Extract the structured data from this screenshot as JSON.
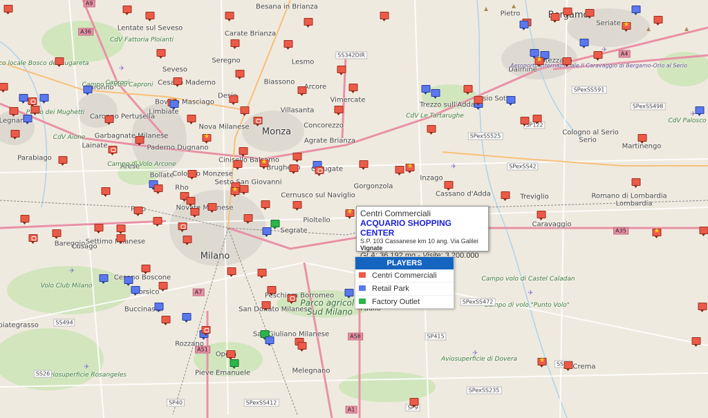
{
  "map": {
    "places": [
      {
        "name": "Milano",
        "kind": "city"
      },
      {
        "name": "Monza",
        "kind": "city"
      },
      {
        "name": "Bergamo",
        "kind": "city"
      },
      {
        "name": "Crema",
        "kind": "town"
      },
      {
        "name": "Caravaggio",
        "kind": "town"
      },
      {
        "name": "Treviglio",
        "kind": "town"
      },
      {
        "name": "Vignate",
        "kind": "town"
      }
    ],
    "labels": [
      "Besana in Brianza",
      "Lentate sul Seveso",
      "Carate Brianza",
      "Seveso",
      "Seregno",
      "Lesmo",
      "Cesano Maderno",
      "Desio",
      "Biassono",
      "Arcore",
      "Vimercate",
      "Saronno",
      "Bovisio Masciago",
      "Limbiate",
      "Villasanta",
      "Concorezzo",
      "Nova Milanese",
      "Caronno Pertusella",
      "Legnano",
      "Garbagnate Milanese",
      "Paderno Dugnano",
      "Agrate Brianza",
      "Lainate",
      "Cinisello Balsamo",
      "Brugherio",
      "Carugate",
      "Gorgonzola",
      "Inzago",
      "Cassano d'Adda",
      "Parabiago",
      "Arese",
      "Bollate",
      "Cologno Monzese",
      "Sesto San Giovanni",
      "Cernusco sul Naviglio",
      "Rho",
      "Pero",
      "Novate Milanese",
      "Pioltello",
      "Segrate",
      "Settimo Milanese",
      "Bareggio",
      "Cusago",
      "Cesano Boscone",
      "Corsico",
      "Buccinasco",
      "San Donato Milanese",
      "Peschiera Borromeo",
      "Paullo",
      "Rozzano",
      "Opera",
      "San Giuliano Milanese",
      "Pieve Emanuele",
      "Melegnano",
      "Abbiategrasso",
      "Trezzo sull'Adda",
      "Osio Sotto",
      "Dalmine",
      "Stezzano",
      "Seriate",
      "Pietro",
      "Cologno al Serio",
      "Martinengo",
      "Romano di Lombardia",
      "Lombardia",
      "Serio"
    ],
    "parks": [
      "CdV Fattoria Ploianti",
      "Parco locale Bosco del Rugareta",
      "Campo di Volo Caproni",
      "Parco dei Mughetti",
      "CdV Aione",
      "Campo di Volo Arcone",
      "CdV Le Tartarughe",
      "CdV Palosco",
      "Volo Club Milano",
      "Aviosuperficie Rosangeles",
      "Aviosuperficie di Dovera",
      "Campo di volo \"Punto Volo\"",
      "Campo volo di Castel Caladan",
      "Caproni"
    ],
    "park_big": [
      "Parco agricolo",
      "Sud Milano"
    ],
    "airport": "Aeroporto internazionale Il Caravaggio di Bergamo-Orio al Serio",
    "roads": [
      "A36",
      "A9",
      "A4",
      "A35",
      "A58",
      "A1",
      "A7",
      "A51",
      "SS342DIR",
      "SS494",
      "SS26",
      "SP40",
      "SPexSS412",
      "SP9",
      "SP415",
      "SPexSS591",
      "SPexSS498",
      "SPexSS525",
      "SPexSS472",
      "SPexSS235",
      "SPexSS42",
      "SP122",
      "SS35"
    ]
  },
  "popup": {
    "category": "Centri Commerciali",
    "name": "ACQUARIO SHOPPING CENTER",
    "address": "S.P. 103 Cassanese km 10 ang. Via Galilei",
    "city": "Vignate",
    "gla_label": "GLA",
    "gla_value": "36.192 mq",
    "visits_label": "Visite",
    "visits_value": "3.200.000"
  },
  "legend": {
    "title": "PLAYERS",
    "items": [
      {
        "label": "Centri Commerciali",
        "color": "#ec5a48"
      },
      {
        "label": "Retail Park",
        "color": "#5b78ee"
      },
      {
        "label": "Factory Outlet",
        "color": "#2bb54b"
      }
    ]
  },
  "colors": {
    "centri_commerciali": "#ec5a48",
    "retail_park": "#5b78ee",
    "factory_outlet": "#2bb54b",
    "motorway": "#e891a6",
    "legend_header": "#1565c0",
    "popup_name": "#1a22d8"
  }
}
